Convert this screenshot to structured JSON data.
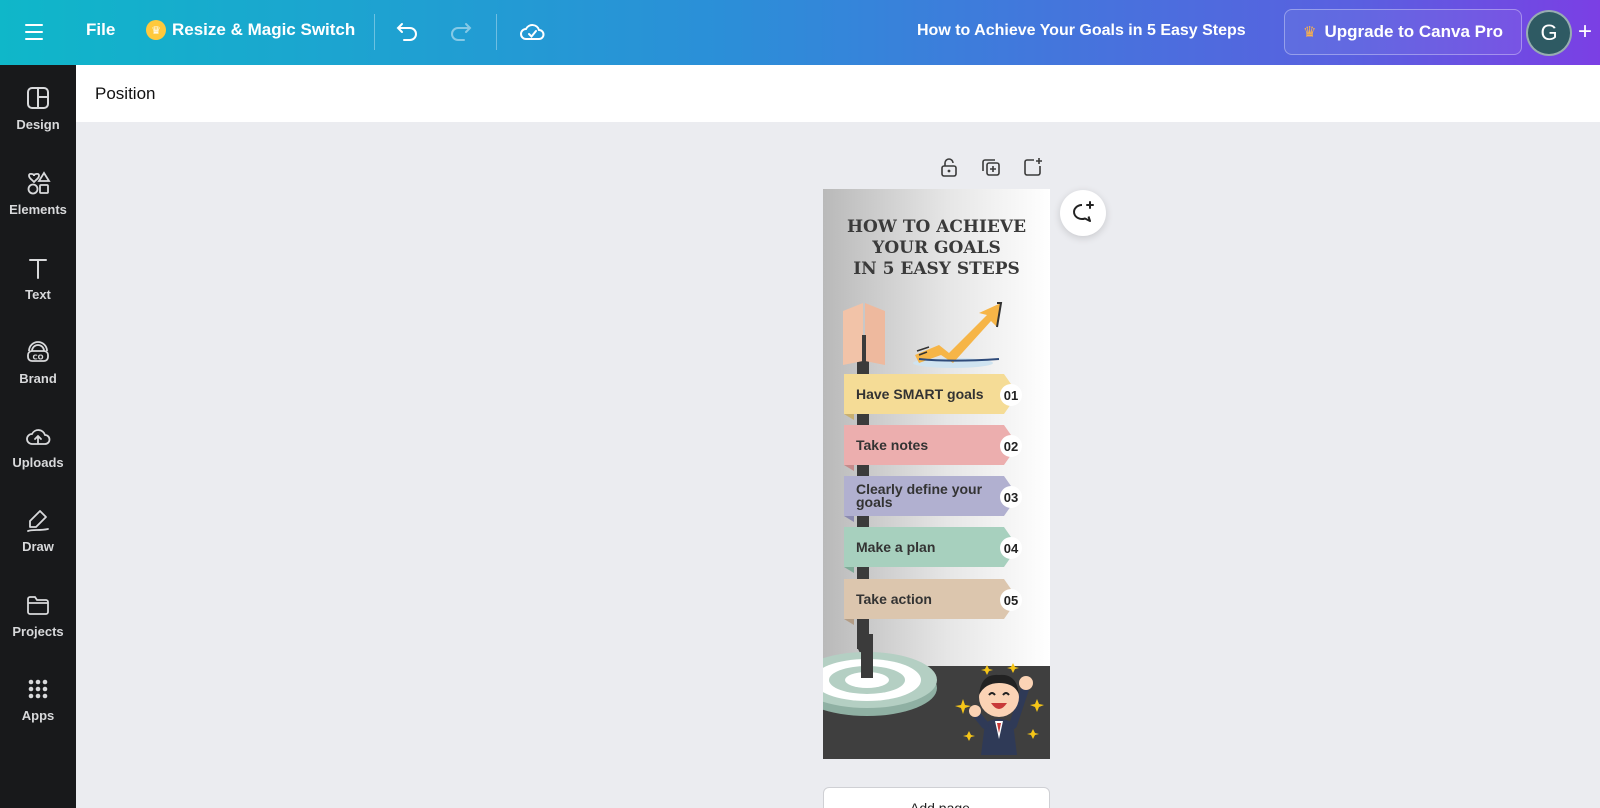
{
  "topbar": {
    "file_label": "File",
    "resize_label": "Resize & Magic Switch",
    "doc_title": "How to Achieve Your Goals in 5 Easy Steps",
    "upgrade_label": "Upgrade to Canva Pro",
    "avatar_initial": "G",
    "plus_label": "+"
  },
  "sidebar": {
    "items": [
      {
        "label": "Design",
        "icon": "design-icon"
      },
      {
        "label": "Elements",
        "icon": "elements-icon"
      },
      {
        "label": "Text",
        "icon": "text-icon"
      },
      {
        "label": "Brand",
        "icon": "brand-icon"
      },
      {
        "label": "Uploads",
        "icon": "uploads-icon"
      },
      {
        "label": "Draw",
        "icon": "draw-icon"
      },
      {
        "label": "Projects",
        "icon": "folder-icon"
      },
      {
        "label": "Apps",
        "icon": "apps-icon"
      }
    ]
  },
  "context_bar": {
    "position_label": "Position"
  },
  "page": {
    "title_lines": [
      "HOW TO ACHIEVE",
      "YOUR GOALS",
      "IN 5 EASY STEPS"
    ],
    "steps": [
      {
        "label": "Have SMART goals",
        "number": "01",
        "color": "#f5dc96"
      },
      {
        "label": "Take notes",
        "number": "02",
        "color": "#ecaeae"
      },
      {
        "label": "Clearly define your goals",
        "number": "03",
        "color": "#b1b0d0"
      },
      {
        "label": "Make a plan",
        "number": "04",
        "color": "#a7d0be"
      },
      {
        "label": "Take action",
        "number": "05",
        "color": "#dcc6ae"
      }
    ]
  },
  "add_page": {
    "label": "Add page"
  },
  "colors": {
    "accent_start": "#0fb7c9",
    "accent_end": "#7b3fe4",
    "sidebar_bg": "#18191b"
  }
}
